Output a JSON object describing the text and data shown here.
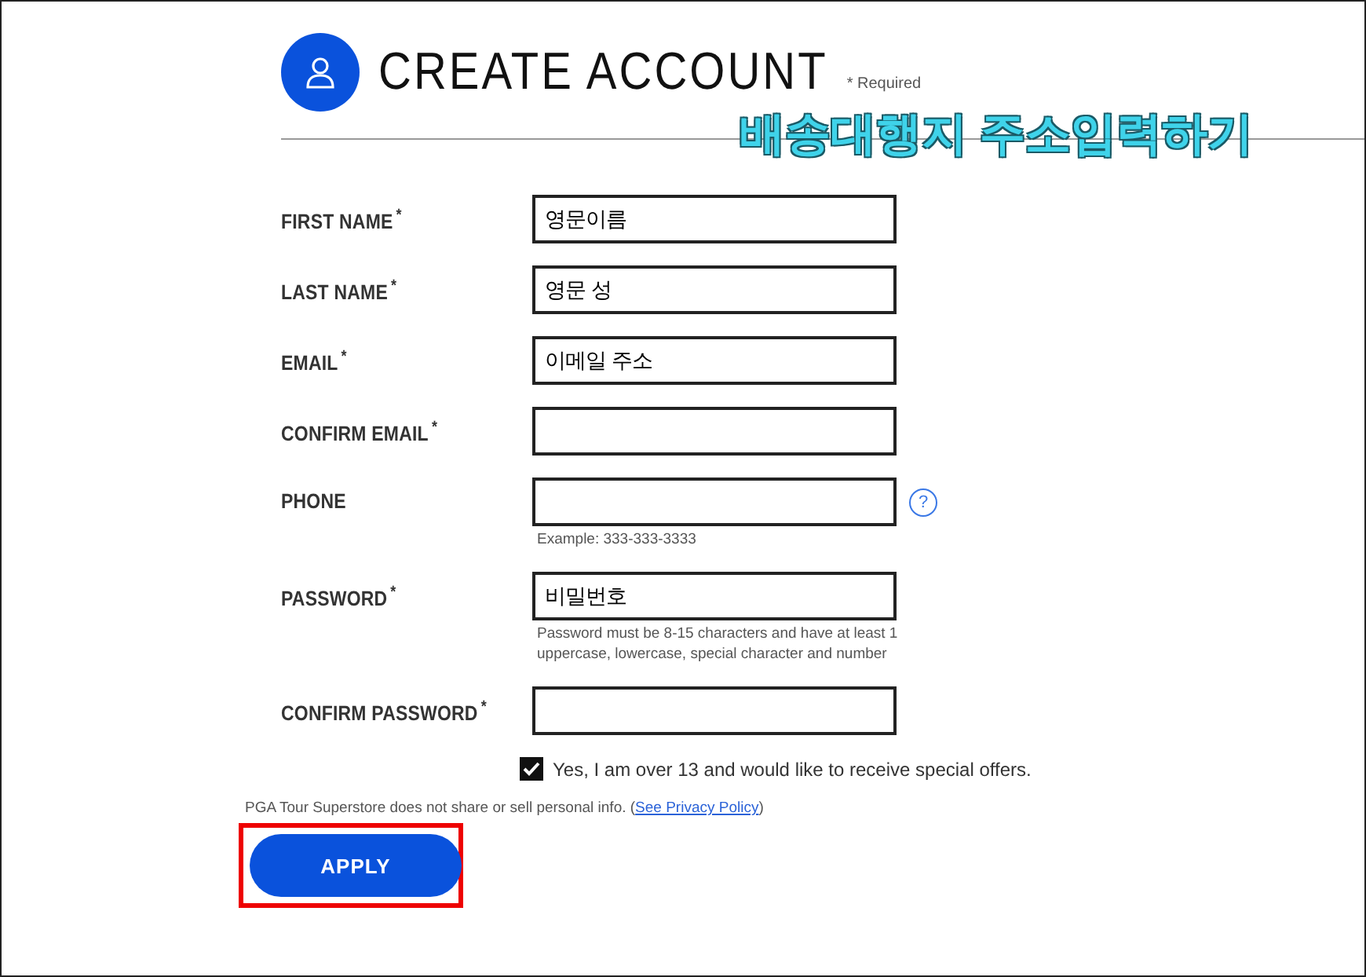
{
  "header": {
    "title": "CREATE ACCOUNT",
    "required_note": "* Required"
  },
  "annotation": "배송대행지 주소입력하기",
  "fields": [
    {
      "label": "FIRST NAME",
      "required_mark": "*",
      "annotation": "영문이름"
    },
    {
      "label": "LAST NAME",
      "required_mark": "*",
      "annotation": "영문 성"
    },
    {
      "label": "EMAIL",
      "required_mark": "*",
      "annotation": "이메일 주소"
    },
    {
      "label": "CONFIRM EMAIL",
      "required_mark": "*"
    },
    {
      "label": "PHONE",
      "help_icon": "?",
      "hint": "Example: 333-333-3333"
    },
    {
      "label": "PASSWORD",
      "required_mark": "*",
      "annotation": "비밀번호",
      "hint": "Password must be 8-15 characters and have at least 1 uppercase, lowercase, special character and number"
    },
    {
      "label": "CONFIRM PASSWORD",
      "required_mark": "*"
    }
  ],
  "offers": {
    "label": "Yes, I am over 13 and would like to receive special offers.",
    "checked": true
  },
  "privacy": {
    "text": "PGA Tour Superstore does not share or sell personal info. (",
    "link": "See Privacy Policy",
    "suffix": ")"
  },
  "apply_button": {
    "label": "APPLY",
    "highlighted": true
  }
}
